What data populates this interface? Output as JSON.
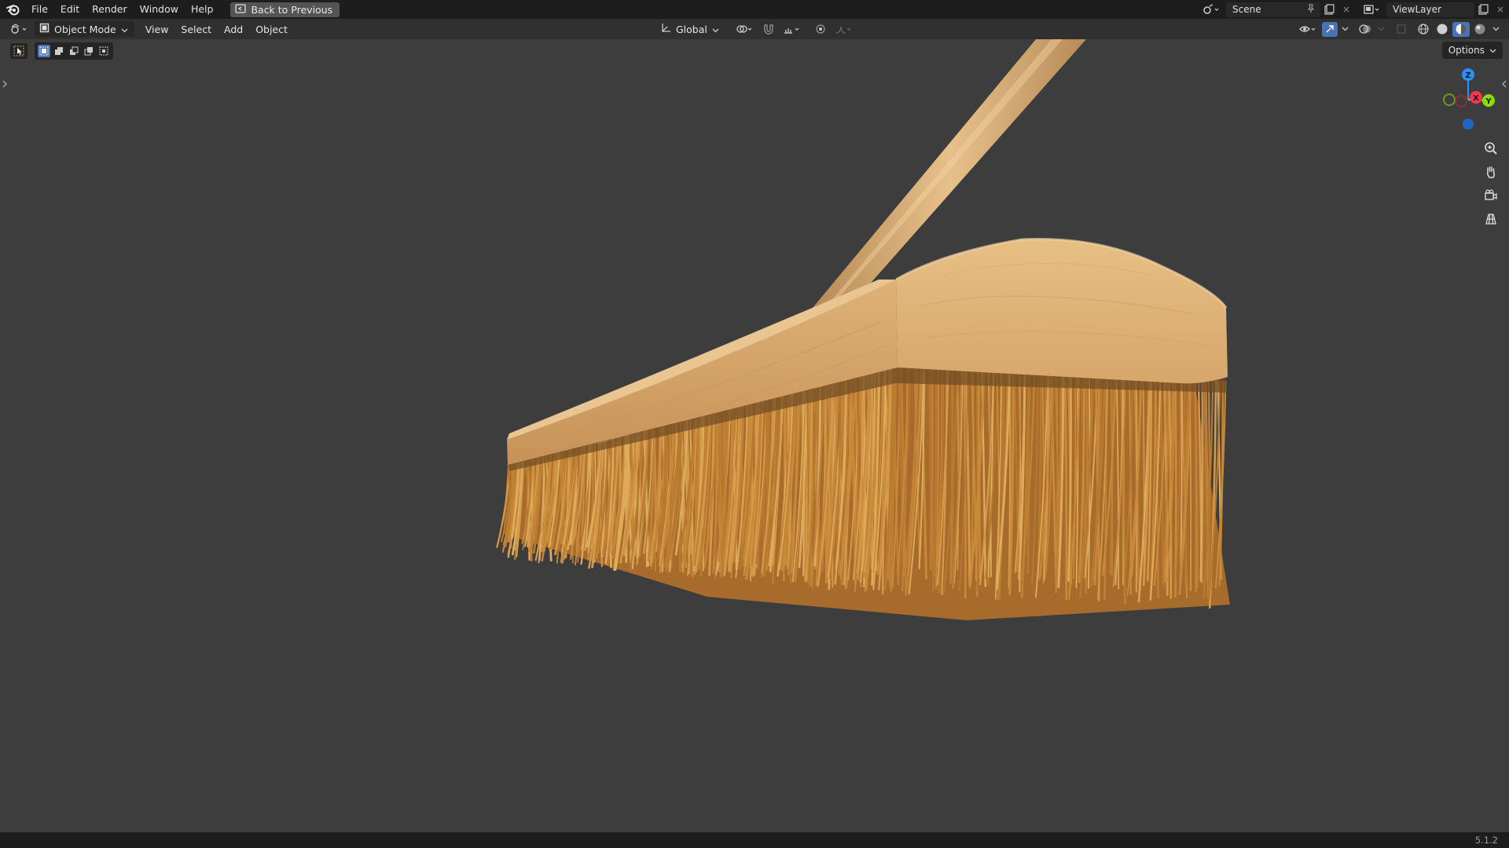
{
  "menu": {
    "items": [
      "File",
      "Edit",
      "Render",
      "Window",
      "Help"
    ],
    "back_button": "Back to Previous"
  },
  "top_right": {
    "scene": "Scene",
    "view_layer": "ViewLayer"
  },
  "header": {
    "mode": "Object Mode",
    "menus": [
      "View",
      "Select",
      "Add",
      "Object"
    ],
    "transform_orientation": "Global",
    "options": "Options"
  },
  "gizmo": {
    "axes": [
      "Z",
      "X",
      "Y"
    ],
    "colors": {
      "x": "#ff3352",
      "y": "#8bdc00",
      "z": "#2890ff"
    }
  },
  "navigation_tools": [
    "zoom-icon",
    "pan-hand-icon",
    "camera-icon",
    "grid-icon"
  ],
  "status": {
    "version": "5.1.2"
  },
  "colors": {
    "accent": "#4772b3",
    "viewport_bg": "#3d3d3d",
    "wood": "#d9a86b",
    "bristle": "#c98a3a"
  }
}
